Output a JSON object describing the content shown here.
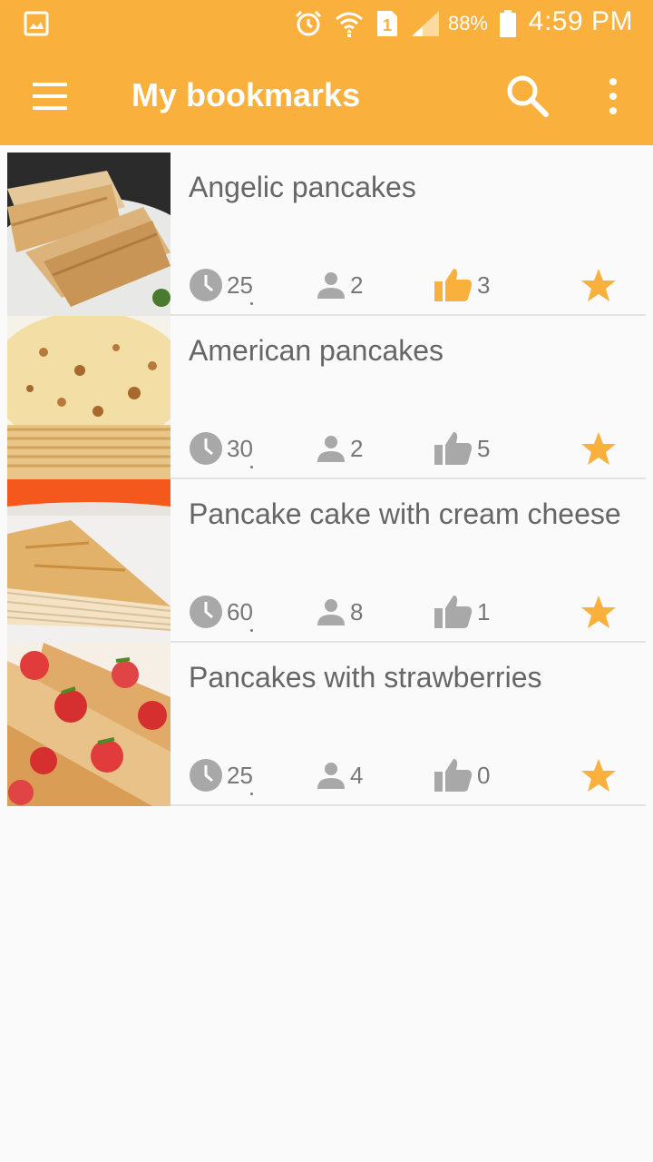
{
  "status_bar": {
    "battery_percent": "88%",
    "time": "4:59 PM",
    "sim_slot": "1",
    "icons": [
      "gallery-icon",
      "alarm-icon",
      "wifi-icon",
      "sim-icon",
      "signal-icon",
      "battery-icon"
    ]
  },
  "app_bar": {
    "title": "My bookmarks",
    "icons": [
      "menu-icon",
      "search-icon",
      "more-vert-icon"
    ]
  },
  "colors": {
    "primary": "#f9b03c",
    "accent": "#f9b03c",
    "text": "#666666",
    "icon_gray": "#a8a8a8"
  },
  "recipes": [
    {
      "title": "Angelic pancakes",
      "time": "25",
      "servings": "2",
      "likes": "3",
      "liked": true,
      "bookmarked": true
    },
    {
      "title": "American pancakes",
      "time": "30",
      "servings": "2",
      "likes": "5",
      "liked": false,
      "bookmarked": true
    },
    {
      "title": "Pancake cake with cream cheese",
      "time": "60",
      "servings": "8",
      "likes": "1",
      "liked": false,
      "bookmarked": true
    },
    {
      "title": "Pancakes with strawberries",
      "time": "25",
      "servings": "4",
      "likes": "0",
      "liked": false,
      "bookmarked": true
    }
  ]
}
